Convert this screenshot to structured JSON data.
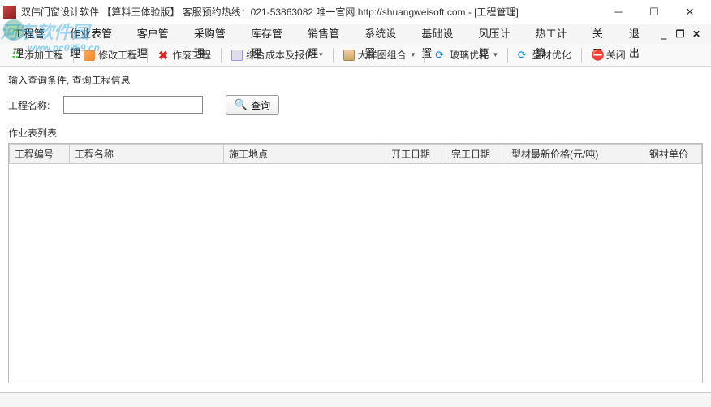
{
  "window": {
    "title": "双伟门窗设计软件      【算料王体验版】    客服预约热线：021-53863082    唯一官网 http://shuangweisoft.com  - [工程管理]"
  },
  "watermark": {
    "text": "河东软件园",
    "url": "www.pc0359.cn"
  },
  "menu": {
    "items": [
      "工程管理",
      "作业表管理",
      "客户管理",
      "采购管理",
      "库存管理",
      "销售管理",
      "系统设置",
      "基础设置",
      "风压计算",
      "热工计算",
      "关于",
      "退出"
    ]
  },
  "toolbar": {
    "add": "添加工程",
    "edit": "修改工程",
    "void": "作废工程",
    "cost": "综合成本及报价",
    "pattern": "大样图组合",
    "glass": "玻璃优化",
    "profile": "型材优化",
    "close": "关闭"
  },
  "search": {
    "hint": "输入查询条件, 查询工程信息",
    "label": "工程名称:",
    "value": "",
    "button": "查询"
  },
  "table": {
    "section": "作业表列表",
    "columns": [
      "工程编号",
      "工程名称",
      "施工地点",
      "开工日期",
      "完工日期",
      "型材最新价格(元/吨)",
      "钢衬单价"
    ],
    "rows": []
  }
}
